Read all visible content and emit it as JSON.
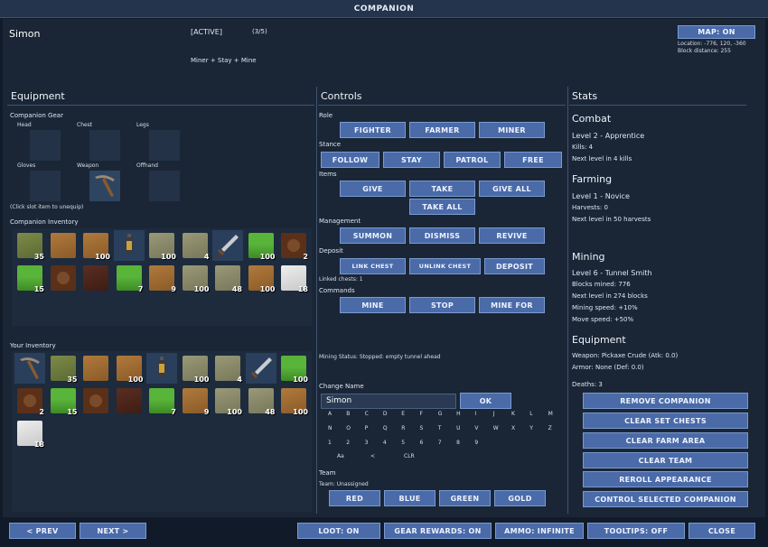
{
  "window": {
    "title": "COMPANION"
  },
  "header": {
    "name": "Simon",
    "status": "[ACTIVE]",
    "count": "(3/5)",
    "mode": "Miner + Stay + Mine",
    "map_button": "MAP: ON",
    "location": "Location: -776, 120, -360",
    "block_distance": "Block distance: 255"
  },
  "equipment": {
    "title": "Equipment",
    "gear_title": "Companion Gear",
    "slots": [
      "Head",
      "Chest",
      "Legs",
      "Gloves",
      "Weapon",
      "Offhand"
    ],
    "hint": "(Click slot item to unequip)",
    "inventory_title": "Companion Inventory",
    "your_inventory_title": "Your Inventory"
  },
  "companion_inventory": [
    {
      "type": "mossy",
      "count": "35"
    },
    {
      "type": "dirt",
      "count": ""
    },
    {
      "type": "dirt",
      "count": "100"
    },
    {
      "type": "lantern",
      "count": ""
    },
    {
      "type": "gravel",
      "count": "100"
    },
    {
      "type": "gravel",
      "count": "4"
    },
    {
      "type": "sword",
      "count": ""
    },
    {
      "type": "grass",
      "count": "100"
    },
    {
      "type": "log",
      "count": "2"
    },
    {
      "type": "grass",
      "count": "15"
    },
    {
      "type": "log",
      "count": ""
    },
    {
      "type": "darklog",
      "count": ""
    },
    {
      "type": "grass",
      "count": "7"
    },
    {
      "type": "dirt",
      "count": "9"
    },
    {
      "type": "gravel",
      "count": "100"
    },
    {
      "type": "gravel",
      "count": "48"
    },
    {
      "type": "dirt",
      "count": "100"
    },
    {
      "type": "snow",
      "count": "18"
    }
  ],
  "your_inventory": [
    {
      "type": "pickaxe",
      "count": ""
    },
    {
      "type": "mossy",
      "count": "35"
    },
    {
      "type": "dirt",
      "count": ""
    },
    {
      "type": "dirt",
      "count": "100"
    },
    {
      "type": "lantern",
      "count": ""
    },
    {
      "type": "gravel",
      "count": "100"
    },
    {
      "type": "gravel",
      "count": "4"
    },
    {
      "type": "sword",
      "count": ""
    },
    {
      "type": "grass",
      "count": "100"
    },
    {
      "type": "log",
      "count": "2"
    },
    {
      "type": "grass",
      "count": "15"
    },
    {
      "type": "log",
      "count": ""
    },
    {
      "type": "darklog",
      "count": ""
    },
    {
      "type": "grass",
      "count": "7"
    },
    {
      "type": "dirt",
      "count": "9"
    },
    {
      "type": "gravel",
      "count": "100"
    },
    {
      "type": "gravel",
      "count": "48"
    },
    {
      "type": "dirt",
      "count": "100"
    },
    {
      "type": "snow",
      "count": "18"
    }
  ],
  "controls": {
    "title": "Controls",
    "role_label": "Role",
    "role_buttons": [
      "FIGHTER",
      "FARMER",
      "MINER"
    ],
    "stance_label": "Stance",
    "stance_buttons": [
      "FOLLOW",
      "STAY",
      "PATROL",
      "FREE"
    ],
    "items_label": "Items",
    "items_buttons": [
      "GIVE",
      "TAKE",
      "GIVE ALL"
    ],
    "take_all": "TAKE ALL",
    "management_label": "Management",
    "management_buttons": [
      "SUMMON",
      "DISMISS",
      "REVIVE"
    ],
    "deposit_label": "Deposit",
    "deposit_buttons": [
      "LINK CHEST",
      "UNLINK CHEST",
      "DEPOSIT"
    ],
    "linked_chests": "Linked chests: 1",
    "commands_label": "Commands",
    "command_buttons": [
      "MINE",
      "STOP",
      "MINE FOR"
    ],
    "mining_status": "Mining Status: Stopped: empty tunnel ahead",
    "change_name_label": "Change Name",
    "name_value": "Simon",
    "ok": "OK",
    "keys_row1": [
      "A",
      "B",
      "C",
      "D",
      "E",
      "F",
      "G",
      "H",
      "I",
      "J",
      "K",
      "L",
      "M"
    ],
    "keys_row2": [
      "N",
      "O",
      "P",
      "Q",
      "R",
      "S",
      "T",
      "U",
      "V",
      "W",
      "X",
      "Y",
      "Z"
    ],
    "keys_row3": [
      "1",
      "2",
      "3",
      "4",
      "5",
      "6",
      "7",
      "8",
      "9"
    ],
    "keys_row4": [
      "Aa",
      "<",
      "CLR"
    ],
    "team_label": "Team",
    "team_value": "Team: Unassigned",
    "team_buttons": [
      "RED",
      "BLUE",
      "GREEN",
      "GOLD"
    ]
  },
  "stats": {
    "title": "Stats",
    "combat_title": "Combat",
    "combat_level": "Level 2 - Apprentice",
    "kills": "Kills: 4",
    "combat_next": "Next level in 4 kills",
    "farming_title": "Farming",
    "farming_level": "Level 1 - Novice",
    "harvests": "Harvests: 0",
    "farming_next": "Next level in 50 harvests",
    "mining_title": "Mining",
    "mining_level": "Level 6 - Tunnel Smith",
    "blocks_mined": "Blocks mined: 776",
    "mining_next": "Next level in 274 blocks",
    "mining_speed": "Mining speed: +10%",
    "move_speed": "Move speed: +50%",
    "equipment_title": "Equipment",
    "weapon": "Weapon: Pickaxe Crude (Atk: 0.0)",
    "armor": "Armor: None (Def: 0.0)",
    "deaths": "Deaths: 3",
    "action_buttons": [
      "REMOVE COMPANION",
      "CLEAR SET CHESTS",
      "CLEAR FARM AREA",
      "CLEAR TEAM",
      "REROLL APPEARANCE",
      "CONTROL SELECTED COMPANION"
    ]
  },
  "footer": {
    "prev": "< PREV",
    "next": "NEXT >",
    "loot": "LOOT: ON",
    "gear_rewards": "GEAR REWARDS: ON",
    "ammo": "AMMO: INFINITE",
    "tooltips": "TOOLTIPS: OFF",
    "close": "CLOSE"
  },
  "colors": {
    "button": "#4a6aa8",
    "panel": "#1a2636",
    "titlebar": "#23344c"
  }
}
